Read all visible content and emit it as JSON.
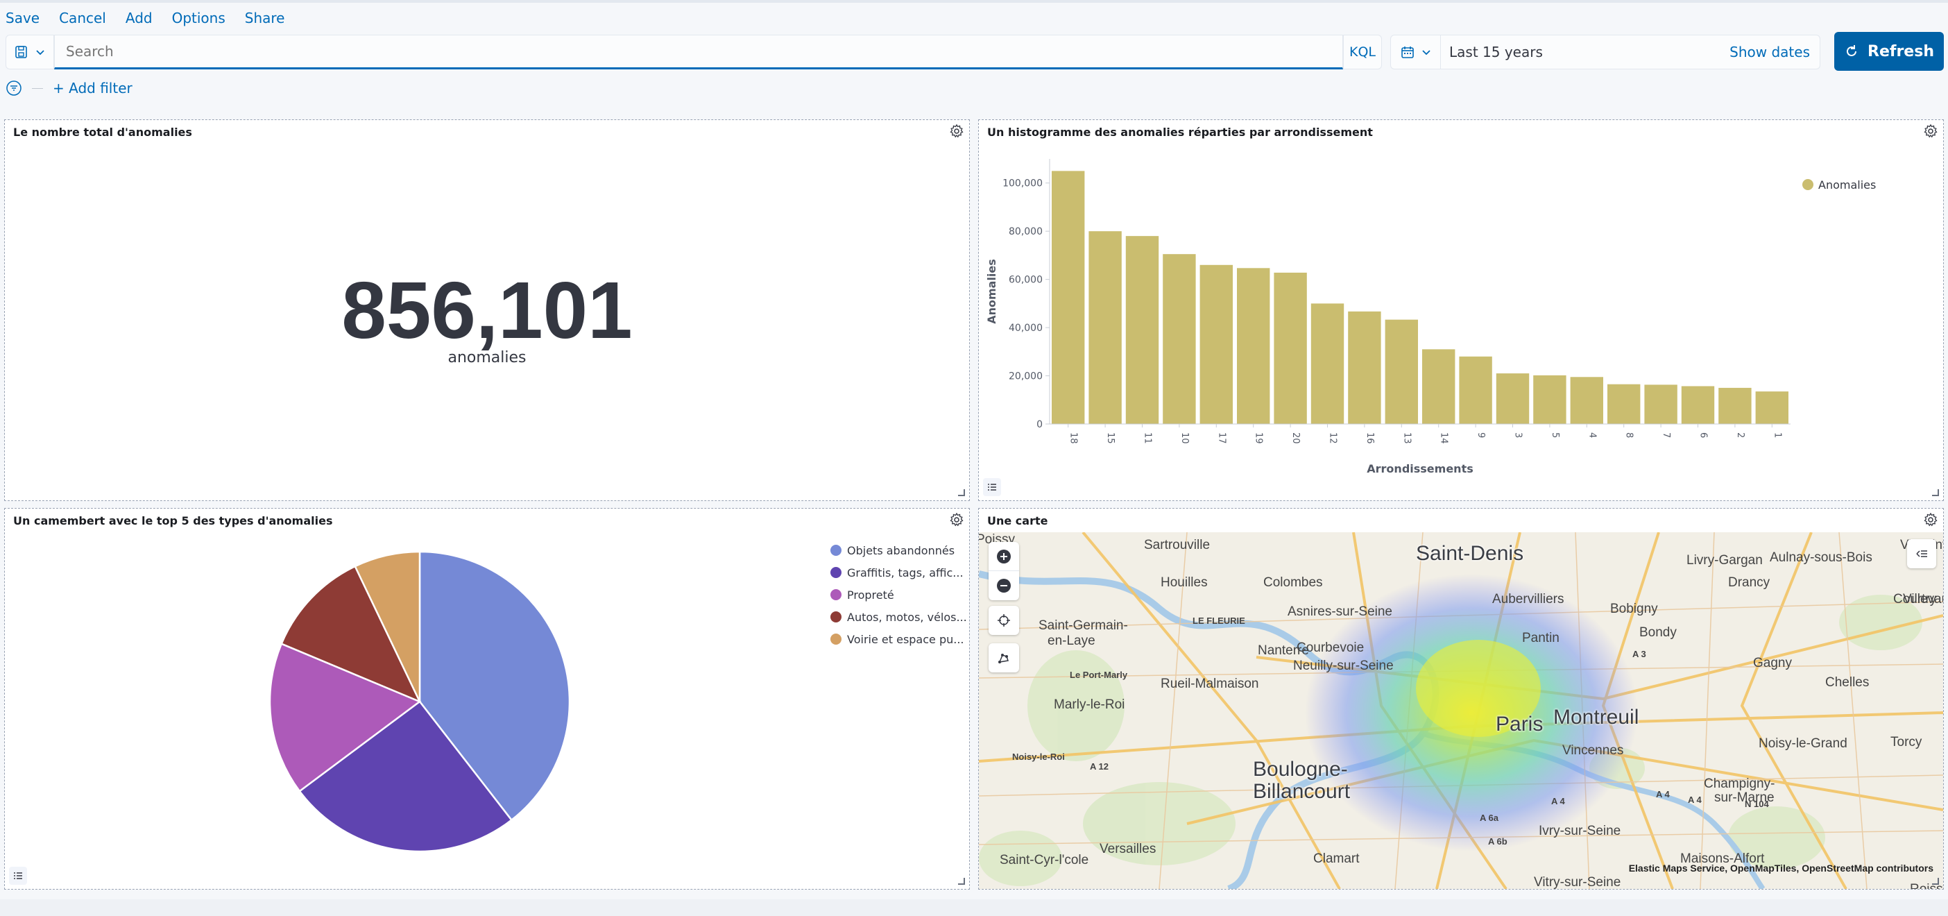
{
  "menu": {
    "save": "Save",
    "cancel": "Cancel",
    "add": "Add",
    "options": "Options",
    "share": "Share"
  },
  "query": {
    "placeholder": "Search",
    "language": "KQL"
  },
  "time": {
    "range": "Last 15 years",
    "show_dates": "Show dates",
    "refresh": "Refresh"
  },
  "filters": {
    "add_filter": "+ Add filter"
  },
  "panels": {
    "metric": {
      "title": "Le nombre total d'anomalies",
      "value": "856,101",
      "label": "anomalies"
    },
    "histogram": {
      "title": "Un histogramme des anomalies réparties par arrondissement"
    },
    "pie": {
      "title": "Un camembert avec le top 5 des types d'anomalies"
    },
    "map": {
      "title": "Une carte",
      "attribution": "Elastic Maps Service, OpenMapTiles, OpenStreetMap contributors",
      "labels": [
        {
          "text": "Saint-Denis",
          "size": "big"
        },
        {
          "text": "Paris",
          "size": "big"
        },
        {
          "text": "Montreuil",
          "size": "big"
        },
        {
          "text": "Boulogne-",
          "size": "big"
        },
        {
          "text": "Billancourt",
          "size": "big"
        },
        {
          "text": "Sartrouville",
          "size": "small"
        },
        {
          "text": "Villepinte",
          "size": "small"
        },
        {
          "text": "Aulnay-sous-Bois",
          "size": "small"
        },
        {
          "text": "Drancy",
          "size": "small"
        },
        {
          "text": "Houilles",
          "size": "small"
        },
        {
          "text": "Colombes",
          "size": "small"
        },
        {
          "text": "Aubervilliers",
          "size": "small"
        },
        {
          "text": "Livry-Gargan",
          "size": "small"
        },
        {
          "text": "Courtry",
          "size": "small"
        },
        {
          "text": "Villevaud",
          "size": "small"
        },
        {
          "text": "Asnires-sur-Seine",
          "size": "small"
        },
        {
          "text": "Bobigny",
          "size": "small"
        },
        {
          "text": "Saint-Germain-",
          "size": "small"
        },
        {
          "text": "en-Laye",
          "size": "small"
        },
        {
          "text": "LE FLEURIE",
          "size": "tiny"
        },
        {
          "text": "Bondy",
          "size": "small"
        },
        {
          "text": "Pantin",
          "size": "small"
        },
        {
          "text": "Nanterre",
          "size": "small"
        },
        {
          "text": "Courbevoie",
          "size": "small"
        },
        {
          "text": "Gagny",
          "size": "small"
        },
        {
          "text": "Le Port-Marly",
          "size": "tiny"
        },
        {
          "text": "Neuilly-sur-Seine",
          "size": "small"
        },
        {
          "text": "Chelles",
          "size": "small"
        },
        {
          "text": "Rueil-Malmaison",
          "size": "small"
        },
        {
          "text": "Marly-le-Roi",
          "size": "small"
        },
        {
          "text": "Torcy",
          "size": "small"
        },
        {
          "text": "Noisy-le-Grand",
          "size": "small"
        },
        {
          "text": "Noisy-le-Roi",
          "size": "tiny"
        },
        {
          "text": "Vincennes",
          "size": "small"
        },
        {
          "text": "Champigny-",
          "size": "small"
        },
        {
          "text": "sur-Marne",
          "size": "small"
        },
        {
          "text": "Ivry-sur-Seine",
          "size": "small"
        },
        {
          "text": "Versailles",
          "size": "small"
        },
        {
          "text": "Saint-Cyr-l'cole",
          "size": "small"
        },
        {
          "text": "Clamart",
          "size": "small"
        },
        {
          "text": "Maisons-Alfort",
          "size": "small"
        },
        {
          "text": "Vitry-sur-Seine",
          "size": "small"
        },
        {
          "text": "Roissy-en-",
          "size": "small"
        },
        {
          "text": "Poissy",
          "size": "small"
        },
        {
          "text": "A 12",
          "size": "tiny"
        },
        {
          "text": "A 3",
          "size": "tiny"
        },
        {
          "text": "A 4",
          "size": "tiny"
        },
        {
          "text": "A 4",
          "size": "tiny"
        },
        {
          "text": "A 4",
          "size": "tiny"
        },
        {
          "text": "N 104",
          "size": "tiny"
        },
        {
          "text": "A 6a",
          "size": "tiny"
        },
        {
          "text": "A 6b",
          "size": "tiny"
        }
      ]
    }
  },
  "colors": {
    "accent": "#006bb8",
    "refresh_bg": "#0061a6",
    "bar": "#cabd6f"
  },
  "icons": {
    "save_query": "save-query-icon",
    "calendar": "calendar-icon",
    "refresh": "refresh-icon",
    "filter": "filter-icon",
    "gear": "gear-icon",
    "legend": "legend-icon",
    "zoom_in": "plus-icon",
    "zoom_out": "minus-icon",
    "locate": "crosshair-icon",
    "draw": "draw-icon",
    "layers": "layers-icon"
  },
  "chart_data": [
    {
      "type": "bar",
      "title": "Un histogramme des anomalies réparties par arrondissement",
      "xlabel": "Arrondissements",
      "ylabel": "Anomalies",
      "categories": [
        "18",
        "15",
        "11",
        "10",
        "17",
        "19",
        "20",
        "12",
        "16",
        "13",
        "14",
        "9",
        "3",
        "5",
        "4",
        "8",
        "7",
        "6",
        "2",
        "1"
      ],
      "series": [
        {
          "name": "Anomalies",
          "color": "#cabd6f",
          "values": [
            105000,
            80000,
            78000,
            70500,
            66000,
            64700,
            62800,
            50000,
            46700,
            43300,
            31000,
            28000,
            21000,
            20200,
            19500,
            16500,
            16300,
            15700,
            15000,
            13500
          ]
        }
      ],
      "ylim": [
        0,
        110000
      ],
      "yticks": [
        0,
        20000,
        40000,
        60000,
        80000,
        100000
      ],
      "ytick_labels": [
        "0",
        "20,000",
        "40,000",
        "60,000",
        "80,000",
        "100,000"
      ],
      "legend": "top-right"
    },
    {
      "type": "pie",
      "title": "Un camembert avec le top 5 des types d'anomalies",
      "labels": [
        "Objets abandonnés",
        "Graffitis, tags, affic...",
        "Propreté",
        "Autos, motos, vélos...",
        "Voirie et espace pu..."
      ],
      "values": [
        39.5,
        25.3,
        16.5,
        11.6,
        7.1
      ],
      "colors": [
        "#7589d6",
        "#5f44b0",
        "#ad5ab9",
        "#8e3b35",
        "#d4a063"
      ],
      "legend": "top-right"
    }
  ]
}
